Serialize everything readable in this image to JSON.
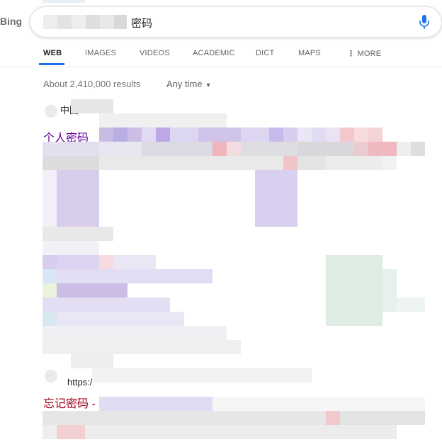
{
  "header": {
    "logo_text": "Bing",
    "query_visible": "密码",
    "mic_icon": "microphone-icon"
  },
  "tabs": [
    {
      "label": "WEB",
      "active": true
    },
    {
      "label": "IMAGES",
      "active": false
    },
    {
      "label": "VIDEOS",
      "active": false
    },
    {
      "label": "ACADEMIC",
      "active": false
    },
    {
      "label": "DICT",
      "active": false
    },
    {
      "label": "MAPS",
      "active": false
    },
    {
      "label": "MORE",
      "active": false
    }
  ],
  "results_info": {
    "count_text": "About 2,410,000 results",
    "time_filter": "Any time"
  },
  "results": [
    {
      "site": "中国…",
      "title": "个人密码"
    },
    {
      "site": "https:/",
      "title": "忘记密码 -"
    }
  ],
  "colors": {
    "accent": "#1a73e8",
    "title_visited": "#660099",
    "title_link": "#a4001a",
    "muted": "#70757a"
  }
}
